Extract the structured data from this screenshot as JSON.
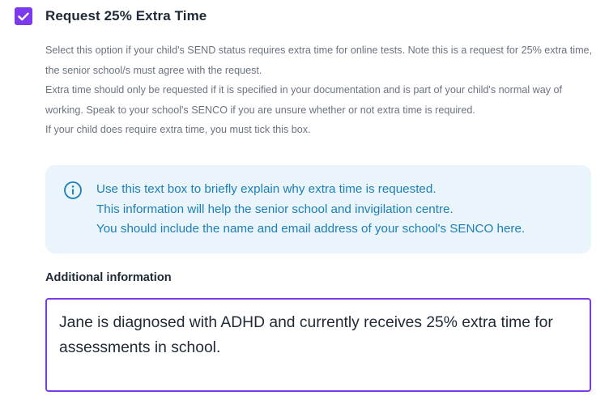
{
  "extra_time": {
    "checked": true,
    "label": "Request 25% Extra Time",
    "description": [
      "Select this option if your child's SEND status requires extra time for online tests. Note this is a request for 25% extra time, the senior school/s must agree with the request.",
      "Extra time should only be requested if it is specified in your documentation and is part of your child's normal way of working. Speak to your school's SENCO if you are unsure whether or not extra time is required.",
      "If your child does require extra time, you must tick this box."
    ]
  },
  "info_box": {
    "icon": "info-icon",
    "lines": [
      "Use this text box to briefly explain why extra time is requested.",
      "This information will help the senior school and invigilation centre.",
      "You should include the name and email address of your school's SENCO here."
    ]
  },
  "additional_information": {
    "label": "Additional information",
    "value": "Jane is diagnosed with ADHD and currently receives 25% extra time for assessments in school."
  },
  "colors": {
    "accent": "#7c3aed",
    "info_background": "#eaf4fb",
    "info_text": "#1c7fb8",
    "muted_text": "#6b7280"
  }
}
